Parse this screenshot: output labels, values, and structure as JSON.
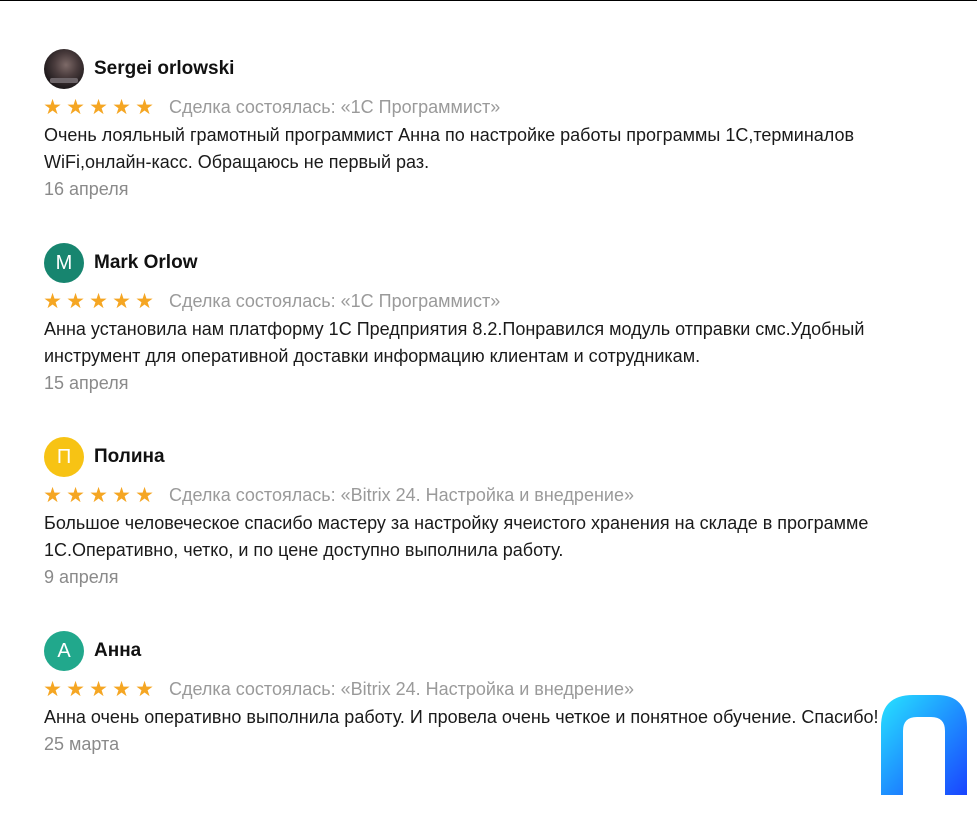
{
  "colors": {
    "star": "#f5a623",
    "meta": "#9a9a9a",
    "date": "#8a8a8a",
    "logo_gradient": [
      "#28e1ff",
      "#1a5cff"
    ]
  },
  "reviews": [
    {
      "author": "Sergei orlowski",
      "avatar": {
        "type": "photo",
        "letter": "",
        "color": "#3a3032"
      },
      "rating": 5,
      "deal": "Сделка состоялась: «1С Программист»",
      "text": "Очень лояльный грамотный программист Анна по настройке работы программы 1С,терминалов WiFi,онлайн-касс. Обращаюсь не первый раз.",
      "date": "16 апреля"
    },
    {
      "author": "Mark Orlow",
      "avatar": {
        "type": "letter",
        "letter": "M",
        "color": "#17856f"
      },
      "rating": 5,
      "deal": "Сделка состоялась: «1С Программист»",
      "text": "Анна установила нам платформу 1С Предприятия 8.2.Понравился модуль отправки смс.Удобный инструмент для оперативной доставки информацию клиентам и сотрудникам.",
      "date": "15 апреля"
    },
    {
      "author": "Полина",
      "avatar": {
        "type": "letter",
        "letter": "П",
        "color": "#f7c314"
      },
      "rating": 5,
      "deal": "Сделка состоялась: «Bitrix 24. Настройка и внедрение»",
      "text": "Большое человеческое спасибо мастеру за настройку ячеистого хранения на складе в программе 1С.Оперативно, четко, и по цене доступно выполнила работу.",
      "date": "9 апреля"
    },
    {
      "author": "Анна",
      "avatar": {
        "type": "letter",
        "letter": "А",
        "color": "#21a88c"
      },
      "rating": 5,
      "deal": "Сделка состоялась: «Bitrix 24. Настройка и внедрение»",
      "text": "Анна очень оперативно выполнила работу. И провела очень четкое и понятное обучение. Спасибо!",
      "date": "25 марта"
    }
  ],
  "logo": {
    "icon": "brand-logo-icon"
  }
}
